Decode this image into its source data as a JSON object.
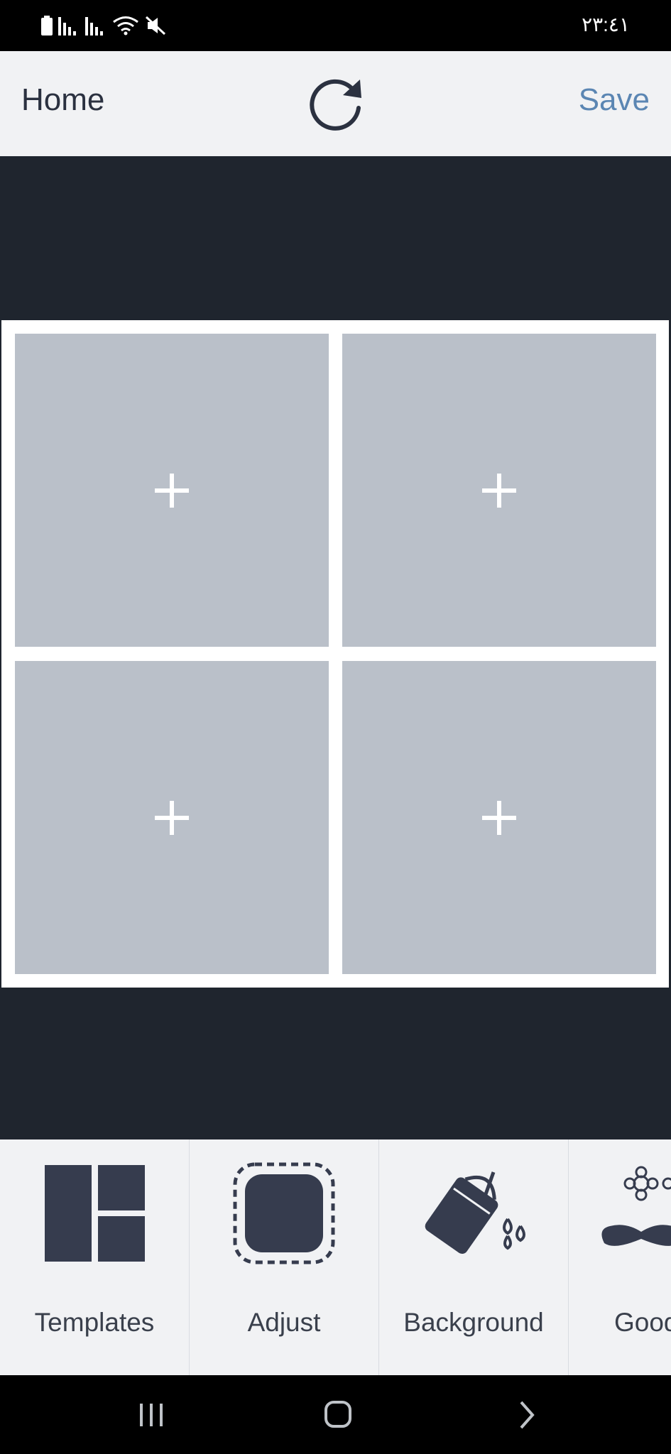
{
  "status_bar": {
    "time": "٢٣:٤١",
    "icons": [
      "battery-icon",
      "signal-icon",
      "signal-icon",
      "wifi-icon",
      "mute-icon"
    ]
  },
  "header": {
    "home_label": "Home",
    "save_label": "Save",
    "refresh_icon": "refresh-icon"
  },
  "collage": {
    "cells": [
      {
        "icon": "plus-icon"
      },
      {
        "icon": "plus-icon"
      },
      {
        "icon": "plus-icon"
      },
      {
        "icon": "plus-icon"
      }
    ]
  },
  "toolbar": {
    "items": [
      {
        "label": "Templates",
        "icon": "templates-icon"
      },
      {
        "label": "Adjust",
        "icon": "adjust-icon"
      },
      {
        "label": "Background",
        "icon": "paint-bucket-icon"
      },
      {
        "label": "Good",
        "icon": "mustache-icon"
      }
    ]
  },
  "navigation": {
    "buttons": [
      "recents-icon",
      "home-icon",
      "back-icon"
    ]
  },
  "colors": {
    "header_bg": "#f1f2f4",
    "canvas_bg": "#1f252e",
    "cell_bg": "#bac0c9",
    "save_accent": "#5b86b3",
    "icon_dark": "#363c4e"
  }
}
